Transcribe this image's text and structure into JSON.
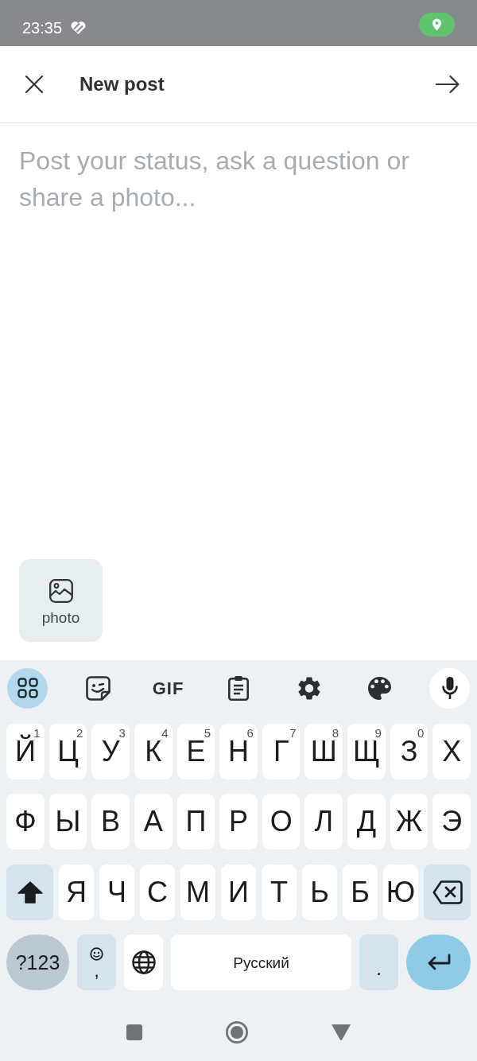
{
  "status_bar": {
    "time": "23:35"
  },
  "header": {
    "title": "New post"
  },
  "composer": {
    "placeholder": "Post your status, ask a question or share a photo..."
  },
  "attachments": [
    {
      "label": "photo"
    }
  ],
  "keyboard": {
    "toolbar": [
      {
        "kind": "apps"
      },
      {
        "kind": "sticker"
      },
      {
        "kind": "gif",
        "label": "GIF"
      },
      {
        "kind": "clipboard"
      },
      {
        "kind": "settings"
      },
      {
        "kind": "theme"
      },
      {
        "kind": "voice"
      }
    ],
    "rows": [
      {
        "keys": [
          {
            "kind": "letter",
            "label": "Й",
            "hint": "1"
          },
          {
            "kind": "letter",
            "label": "Ц",
            "hint": "2"
          },
          {
            "kind": "letter",
            "label": "У",
            "hint": "3"
          },
          {
            "kind": "letter",
            "label": "К",
            "hint": "4"
          },
          {
            "kind": "letter",
            "label": "Е",
            "hint": "5"
          },
          {
            "kind": "letter",
            "label": "Н",
            "hint": "6"
          },
          {
            "kind": "letter",
            "label": "Г",
            "hint": "7"
          },
          {
            "kind": "letter",
            "label": "Ш",
            "hint": "8"
          },
          {
            "kind": "letter",
            "label": "Щ",
            "hint": "9"
          },
          {
            "kind": "letter",
            "label": "З",
            "hint": "0"
          },
          {
            "kind": "letter",
            "label": "Х"
          }
        ]
      },
      {
        "keys": [
          {
            "kind": "letter",
            "label": "Ф"
          },
          {
            "kind": "letter",
            "label": "Ы"
          },
          {
            "kind": "letter",
            "label": "В"
          },
          {
            "kind": "letter",
            "label": "А"
          },
          {
            "kind": "letter",
            "label": "П"
          },
          {
            "kind": "letter",
            "label": "Р"
          },
          {
            "kind": "letter",
            "label": "О"
          },
          {
            "kind": "letter",
            "label": "Л"
          },
          {
            "kind": "letter",
            "label": "Д"
          },
          {
            "kind": "letter",
            "label": "Ж"
          },
          {
            "kind": "letter",
            "label": "Э"
          }
        ]
      },
      {
        "keys": [
          {
            "kind": "shift"
          },
          {
            "kind": "letter",
            "label": "Я"
          },
          {
            "kind": "letter",
            "label": "Ч"
          },
          {
            "kind": "letter",
            "label": "С"
          },
          {
            "kind": "letter",
            "label": "М"
          },
          {
            "kind": "letter",
            "label": "И"
          },
          {
            "kind": "letter",
            "label": "Т"
          },
          {
            "kind": "letter",
            "label": "Ь"
          },
          {
            "kind": "letter",
            "label": "Б"
          },
          {
            "kind": "letter",
            "label": "Ю"
          },
          {
            "kind": "backspace"
          }
        ]
      },
      {
        "keys": [
          {
            "kind": "symbols",
            "label": "?123"
          },
          {
            "kind": "emoji_comma",
            "label": ","
          },
          {
            "kind": "language"
          },
          {
            "kind": "space",
            "label": "Русский"
          },
          {
            "kind": "period",
            "label": "."
          },
          {
            "kind": "enter"
          }
        ]
      }
    ]
  }
}
